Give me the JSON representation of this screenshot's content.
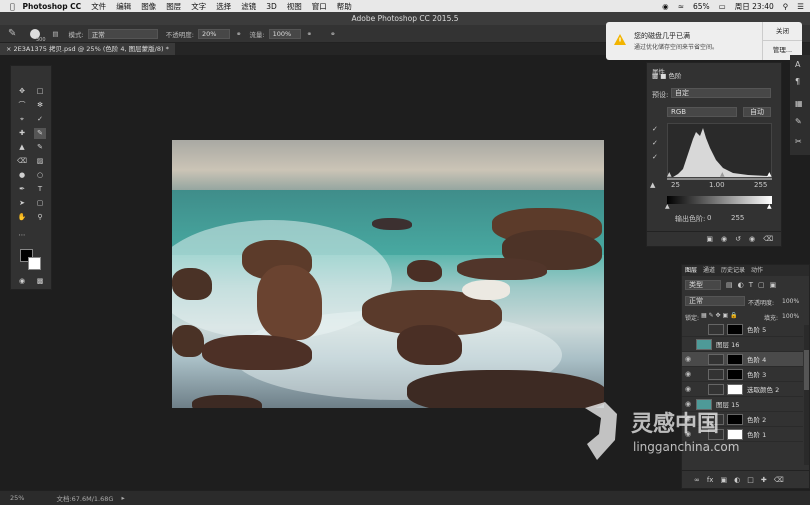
{
  "menubar": {
    "app": "Photoshop CC",
    "items": [
      "文件",
      "编辑",
      "图像",
      "图层",
      "文字",
      "选择",
      "滤镜",
      "3D",
      "视图",
      "窗口",
      "帮助"
    ],
    "status": {
      "battery": "65%",
      "time": "周日 23:40"
    }
  },
  "title": "Adobe Photoshop CC 2015.5",
  "options": {
    "size": "300",
    "mode_label": "模式:",
    "mode_value": "正常",
    "opacity_label": "不透明度:",
    "opacity_value": "20%",
    "flow_label": "流量:",
    "flow_value": "100%"
  },
  "document_tab": "2E3A1375 拷贝.psd @ 25% (色阶 4, 图层蒙版/8) *",
  "notification": {
    "title": "您的磁盘几乎已满",
    "body": "通过优化储存空间来节省空间。",
    "close": "关闭",
    "manage": "管理..."
  },
  "properties": {
    "tab": "属性",
    "panel_name": "色阶",
    "preset_label": "预设:",
    "preset_value": "自定",
    "channel": "RGB",
    "auto": "自动",
    "input_black": "25",
    "input_gamma": "1.00",
    "input_white": "255",
    "output_label": "输出色阶:",
    "output_black": "0",
    "output_white": "255"
  },
  "layers_panel": {
    "tabs": [
      "图层",
      "通道",
      "历史记录",
      "动作"
    ],
    "filter": "类型",
    "blend": "正常",
    "opacity_label": "不透明度:",
    "opacity": "100%",
    "lock_label": "锁定:",
    "fill_label": "填充:",
    "fill": "100%",
    "layers": [
      {
        "name": "色阶 5",
        "visible": false
      },
      {
        "name": "图层 16",
        "visible": false
      },
      {
        "name": "色阶 4",
        "visible": true
      },
      {
        "name": "色阶 3",
        "visible": true
      },
      {
        "name": "选取颜色 2",
        "visible": true
      },
      {
        "name": "图层 15",
        "visible": true
      },
      {
        "name": "色阶 2",
        "visible": true
      },
      {
        "name": "色阶 1",
        "visible": true
      }
    ]
  },
  "status": {
    "zoom": "25%",
    "doc": "文档:67.6M/1.68G"
  },
  "watermark": {
    "cn": "灵感中国",
    "en": "lingganchina.com"
  }
}
